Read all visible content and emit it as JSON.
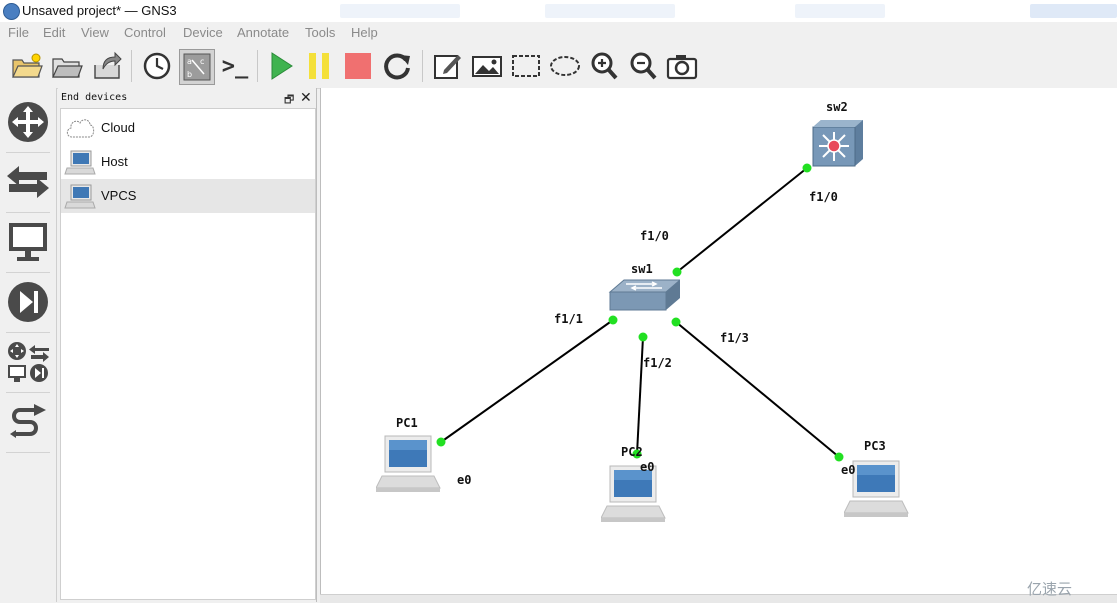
{
  "window": {
    "title": "Unsaved project* — GNS3"
  },
  "menu": [
    "File",
    "Edit",
    "View",
    "Control",
    "Device",
    "Annotate",
    "Tools",
    "Help"
  ],
  "toolbar": {
    "buttons": [
      "new-project",
      "open-project",
      "save-project",
      "snapshot",
      "show-interface-labels",
      "console-all",
      "start-all",
      "suspend-all",
      "stop-all",
      "reload-all",
      "add-note",
      "insert-image",
      "draw-rectangle",
      "draw-ellipse",
      "zoom-in",
      "zoom-out",
      "screenshot"
    ],
    "console_glyph": ">_"
  },
  "dock": {
    "title": "End devices",
    "float_glyph": "🗗",
    "close_glyph": "✕",
    "devices": [
      {
        "label": "Cloud",
        "icon": "cloud-icon"
      },
      {
        "label": "Host",
        "icon": "host-icon"
      },
      {
        "label": "VPCS",
        "icon": "vpcs-icon",
        "selected": true
      }
    ]
  },
  "topology": {
    "nodes": [
      {
        "name": "sw2",
        "type": "multilayer-switch"
      },
      {
        "name": "sw1",
        "type": "ethernet-switch"
      },
      {
        "name": "PC1",
        "type": "vpcs"
      },
      {
        "name": "PC2",
        "type": "vpcs"
      },
      {
        "name": "PC3",
        "type": "vpcs"
      }
    ],
    "links": [
      {
        "from": "sw1",
        "from_port": "f1/0",
        "to": "sw2",
        "to_port": "f1/0"
      },
      {
        "from": "sw1",
        "from_port": "f1/1",
        "to": "PC1",
        "to_port": "e0"
      },
      {
        "from": "sw1",
        "from_port": "f1/2",
        "to": "PC2",
        "to_port": "e0"
      },
      {
        "from": "sw1",
        "from_port": "f1/3",
        "to": "PC3",
        "to_port": "e0"
      }
    ],
    "port_labels": {
      "sw2_f10": "f1/0",
      "sw1_f10": "f1/0",
      "sw1_f11": "f1/1",
      "sw1_f12": "f1/2",
      "sw1_f13": "f1/3",
      "pc1_e0": "e0",
      "pc2_e0": "e0",
      "pc3_e0": "e0"
    },
    "link_color": "#000000",
    "port_status_color": "#22e022"
  },
  "watermark": "亿速云"
}
